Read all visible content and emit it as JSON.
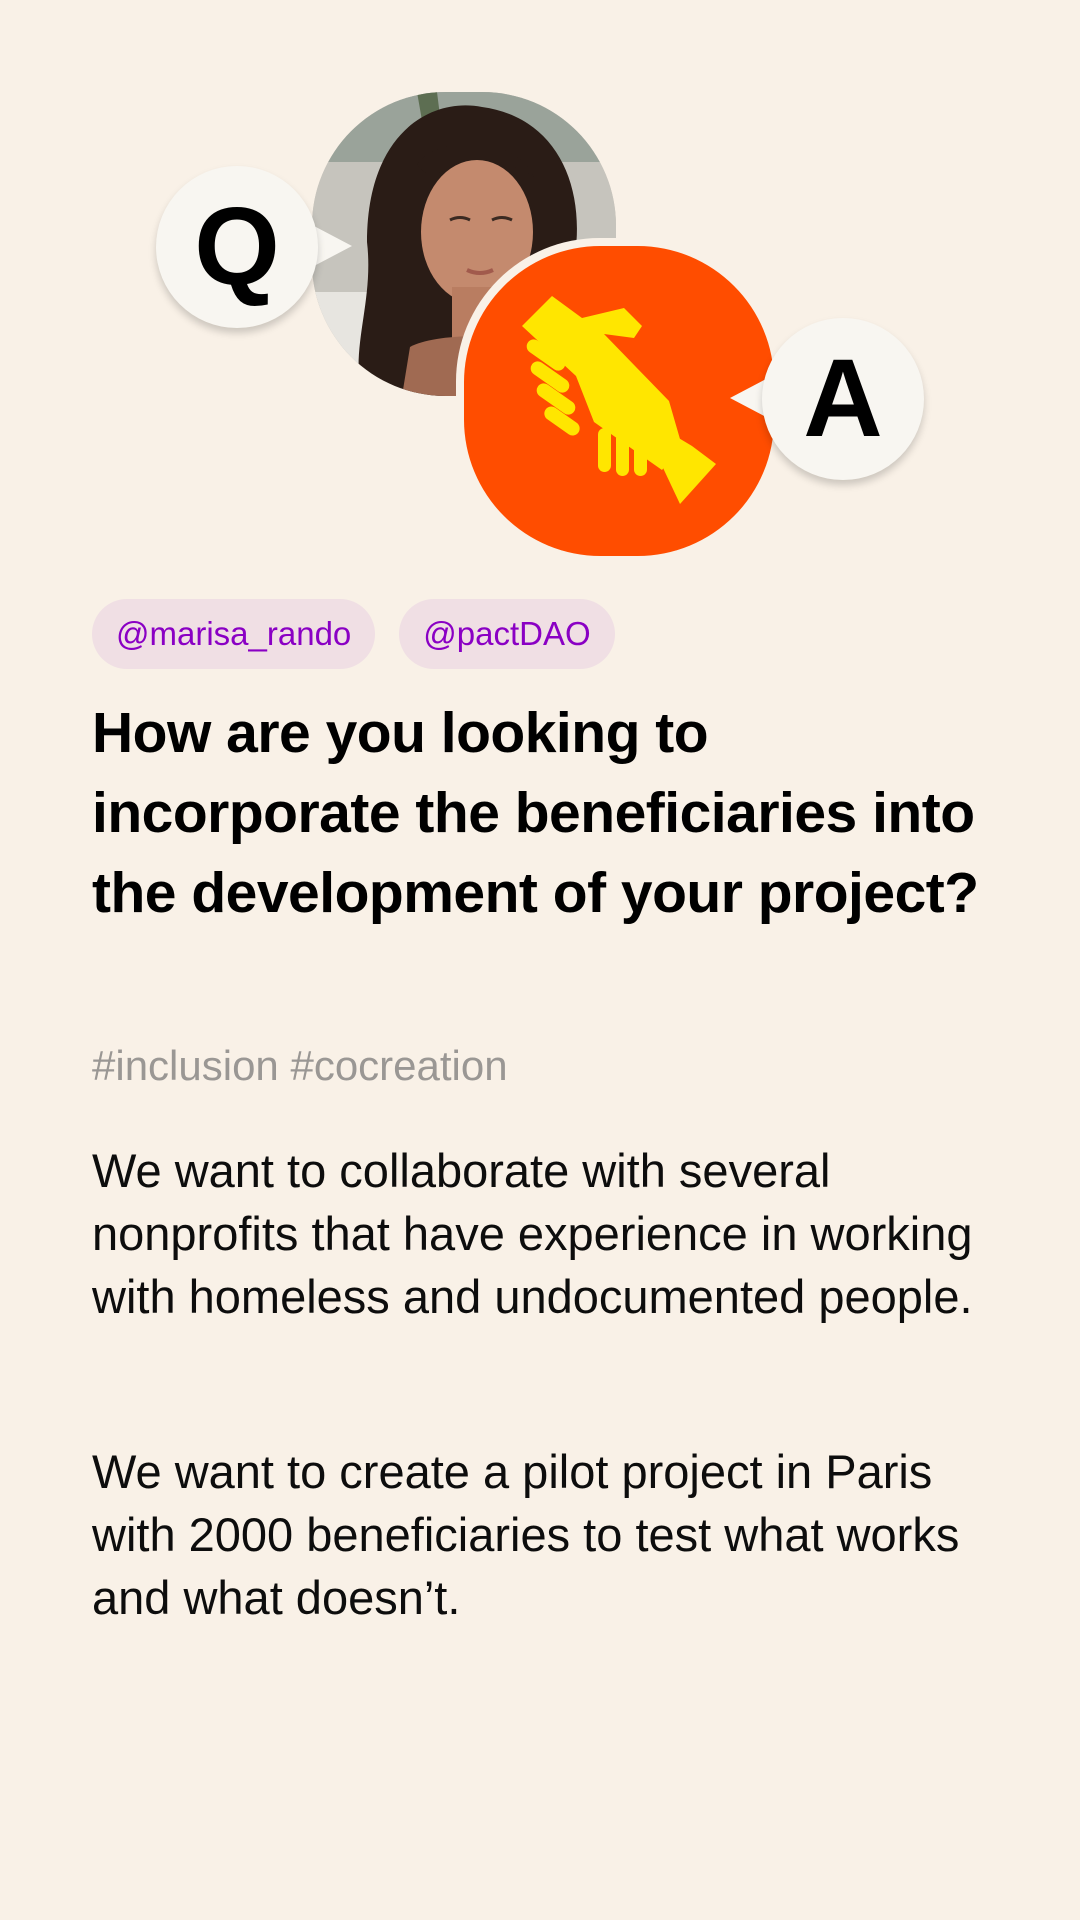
{
  "hero": {
    "question_badge": "Q",
    "answer_badge": "A",
    "avatar_alt": "Profile photo of @marisa_rando",
    "logo_icon": "handshake-icon"
  },
  "tags": [
    {
      "label": "@marisa_rando"
    },
    {
      "label": "@pactDAO"
    }
  ],
  "question": "How are you looking to incorporate the beneficiaries into the development of your project?",
  "hashtags": "#inclusion #cocreation",
  "answer": {
    "paragraphs": [
      "We want to collaborate with several nonprofits that have experience in working with homeless and undocumented people.",
      "We want to create a pilot project in Paris with 2000 beneficiaries to test what works and what doesn’t."
    ]
  },
  "colors": {
    "background": "#f9f1e7",
    "tag_background": "#f0dfe4",
    "tag_text": "#8a00c4",
    "logo_background": "#ff4d00",
    "logo_icon": "#ffe600",
    "hashtag_text": "#9a9794",
    "bubble": "#f8f6f1"
  }
}
